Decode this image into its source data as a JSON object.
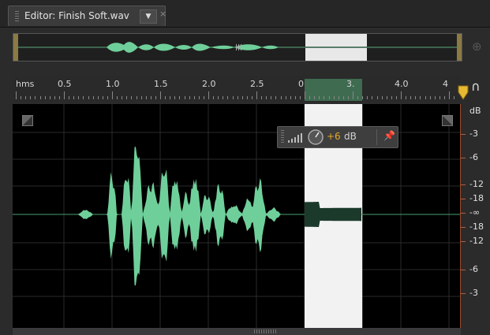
{
  "tab": {
    "title": "Editor: Finish Soft.wav",
    "menu_glyph": "▼",
    "close_glyph": "×"
  },
  "ruler": {
    "unit_label": "hms",
    "labels": [
      {
        "t": 0.5,
        "text": "0.5"
      },
      {
        "t": 1.0,
        "text": "1.0"
      },
      {
        "t": 1.5,
        "text": "1.5"
      },
      {
        "t": 2.0,
        "text": "2.0"
      },
      {
        "t": 2.5,
        "text": "2.5"
      },
      {
        "t": 3.0,
        "text": "0"
      },
      {
        "t": 3.5,
        "text": "3."
      },
      {
        "t": 4.0,
        "text": "4.0"
      },
      {
        "t": 4.5,
        "text": "4"
      }
    ],
    "selection": {
      "start": 3.0,
      "end": 3.6
    }
  },
  "hud": {
    "volume_value": "+6",
    "volume_unit": "dB",
    "pin_icon": "pin-icon"
  },
  "db_scale": {
    "header": "dB",
    "marks": [
      {
        "v": -3,
        "text": "-3"
      },
      {
        "v": -6,
        "text": "-6"
      },
      {
        "v": -12,
        "text": "-12"
      },
      {
        "v": -18,
        "text": "-18"
      },
      {
        "v": "inf",
        "text": "-∞"
      },
      {
        "v": -18,
        "text": "-18"
      },
      {
        "v": -12,
        "text": "-12"
      },
      {
        "v": -6,
        "text": "-6"
      },
      {
        "v": -3,
        "text": "-3"
      }
    ]
  },
  "colors": {
    "waveform": "#6fcf9a",
    "selection": "#f2f2f2",
    "selected_waveform": "#1c3a2c",
    "playhead": "#e8b832"
  }
}
